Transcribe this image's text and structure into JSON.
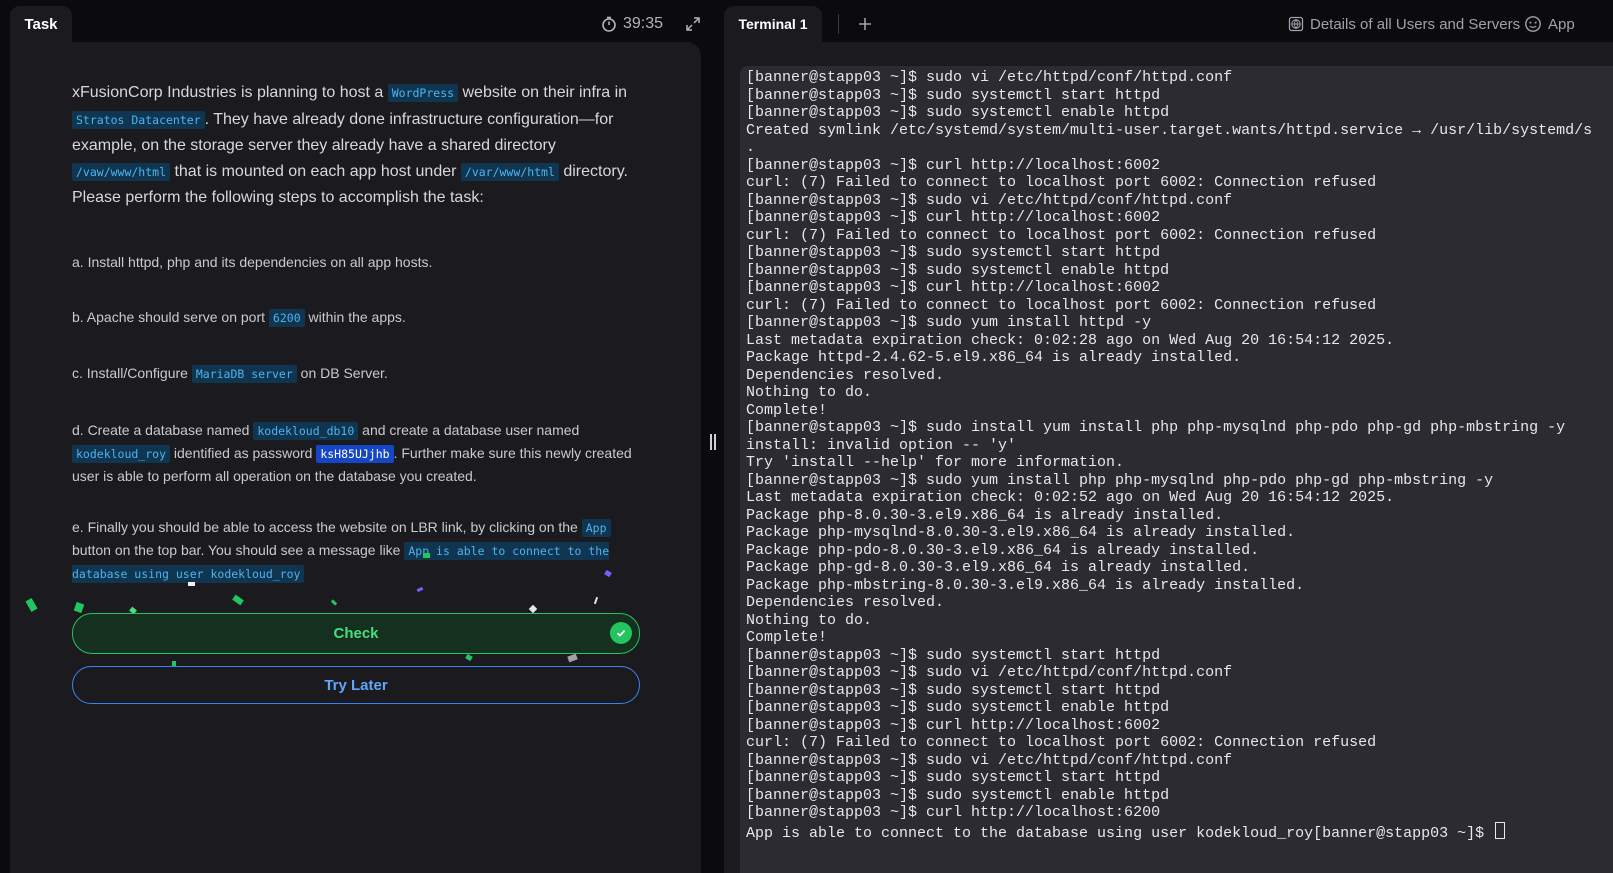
{
  "task_tab": {
    "label": "Task"
  },
  "timer": {
    "value": "39:35"
  },
  "task": {
    "intro": [
      "xFusionCorp Industries is planning to host a ",
      "WordPress",
      " website on their infra in ",
      "Stratos Datacenter",
      ". They have already done infrastructure configuration—for example, on the storage server they already have a shared directory ",
      "/vaw/www/html",
      " that is mounted on each app host under ",
      "/var/www/html",
      " directory. Please perform the following steps to accomplish the task:"
    ],
    "step_a": "a. Install httpd, php and its dependencies on all app hosts.",
    "step_b": [
      "b. Apache should serve on port ",
      "6200",
      " within the apps."
    ],
    "step_c": [
      "c. Install/Configure ",
      "MariaDB server",
      " on DB Server."
    ],
    "step_d": [
      "d. Create a database named ",
      "kodekloud_db10",
      " and create a database user named ",
      "kodekloud_roy",
      " identified as password ",
      "ksH85UJjhb",
      ". Further make sure this newly created user is able to perform all operation on the database you created."
    ],
    "step_e": [
      "e. Finally you should be able to access the website on LBR link, by clicking on the ",
      "App",
      " button on the top bar. You should see a message like ",
      "App is able to connect to the database using user kodekloud_roy"
    ]
  },
  "buttons": {
    "check_label": "Check",
    "try_later_label": "Try Later"
  },
  "terminal_tab": {
    "label": "Terminal 1"
  },
  "top_links": {
    "details": "Details of all Users and Servers",
    "app": "App"
  },
  "terminal": {
    "lines": [
      "[banner@stapp03 ~]$ sudo vi /etc/httpd/conf/httpd.conf",
      "[banner@stapp03 ~]$ sudo systemctl start httpd",
      "[banner@stapp03 ~]$ sudo systemctl enable httpd",
      "Created symlink /etc/systemd/system/multi-user.target.wants/httpd.service → /usr/lib/systemd/s",
      ".",
      "[banner@stapp03 ~]$ curl http://localhost:6002",
      "curl: (7) Failed to connect to localhost port 6002: Connection refused",
      "[banner@stapp03 ~]$ sudo vi /etc/httpd/conf/httpd.conf",
      "[banner@stapp03 ~]$ curl http://localhost:6002",
      "curl: (7) Failed to connect to localhost port 6002: Connection refused",
      "[banner@stapp03 ~]$ sudo systemctl start httpd",
      "[banner@stapp03 ~]$ sudo systemctl enable httpd",
      "[banner@stapp03 ~]$ curl http://localhost:6002",
      "curl: (7) Failed to connect to localhost port 6002: Connection refused",
      "[banner@stapp03 ~]$ sudo yum install httpd -y",
      "Last metadata expiration check: 0:02:28 ago on Wed Aug 20 16:54:12 2025.",
      "Package httpd-2.4.62-5.el9.x86_64 is already installed.",
      "Dependencies resolved.",
      "Nothing to do.",
      "Complete!",
      "[banner@stapp03 ~]$ sudo install yum install php php-mysqlnd php-pdo php-gd php-mbstring -y",
      "install: invalid option -- 'y'",
      "Try 'install --help' for more information.",
      "[banner@stapp03 ~]$ sudo yum install php php-mysqlnd php-pdo php-gd php-mbstring -y",
      "Last metadata expiration check: 0:02:52 ago on Wed Aug 20 16:54:12 2025.",
      "Package php-8.0.30-3.el9.x86_64 is already installed.",
      "Package php-mysqlnd-8.0.30-3.el9.x86_64 is already installed.",
      "Package php-pdo-8.0.30-3.el9.x86_64 is already installed.",
      "Package php-gd-8.0.30-3.el9.x86_64 is already installed.",
      "Package php-mbstring-8.0.30-3.el9.x86_64 is already installed.",
      "Dependencies resolved.",
      "Nothing to do.",
      "Complete!",
      "[banner@stapp03 ~]$ sudo systemctl start httpd",
      "[banner@stapp03 ~]$ sudo vi /etc/httpd/conf/httpd.conf",
      "[banner@stapp03 ~]$ sudo systemctl start httpd",
      "[banner@stapp03 ~]$ sudo systemctl enable httpd",
      "[banner@stapp03 ~]$ curl http://localhost:6002",
      "curl: (7) Failed to connect to localhost port 6002: Connection refused",
      "[banner@stapp03 ~]$ sudo vi /etc/httpd/conf/httpd.conf",
      "[banner@stapp03 ~]$ sudo systemctl start httpd",
      "[banner@stapp03 ~]$ sudo systemctl enable httpd",
      "[banner@stapp03 ~]$ curl http://localhost:6200",
      "App is able to connect to the database using user kodekloud_roy[banner@stapp03 ~]$ "
    ]
  },
  "colors": {
    "background": "#0b0b0e",
    "panel": "#1b1b1f",
    "terminal_bg": "#2b2b31",
    "code_bg": "#0f3550",
    "code_text": "#4fb3ee",
    "check_green": "#22c55e",
    "try_later_blue": "#3b82f6"
  },
  "icons": [
    "timer-icon",
    "expand-icon",
    "check-circle-icon",
    "plus-icon",
    "globe-icon",
    "app-icon",
    "resize-handle-icon"
  ]
}
